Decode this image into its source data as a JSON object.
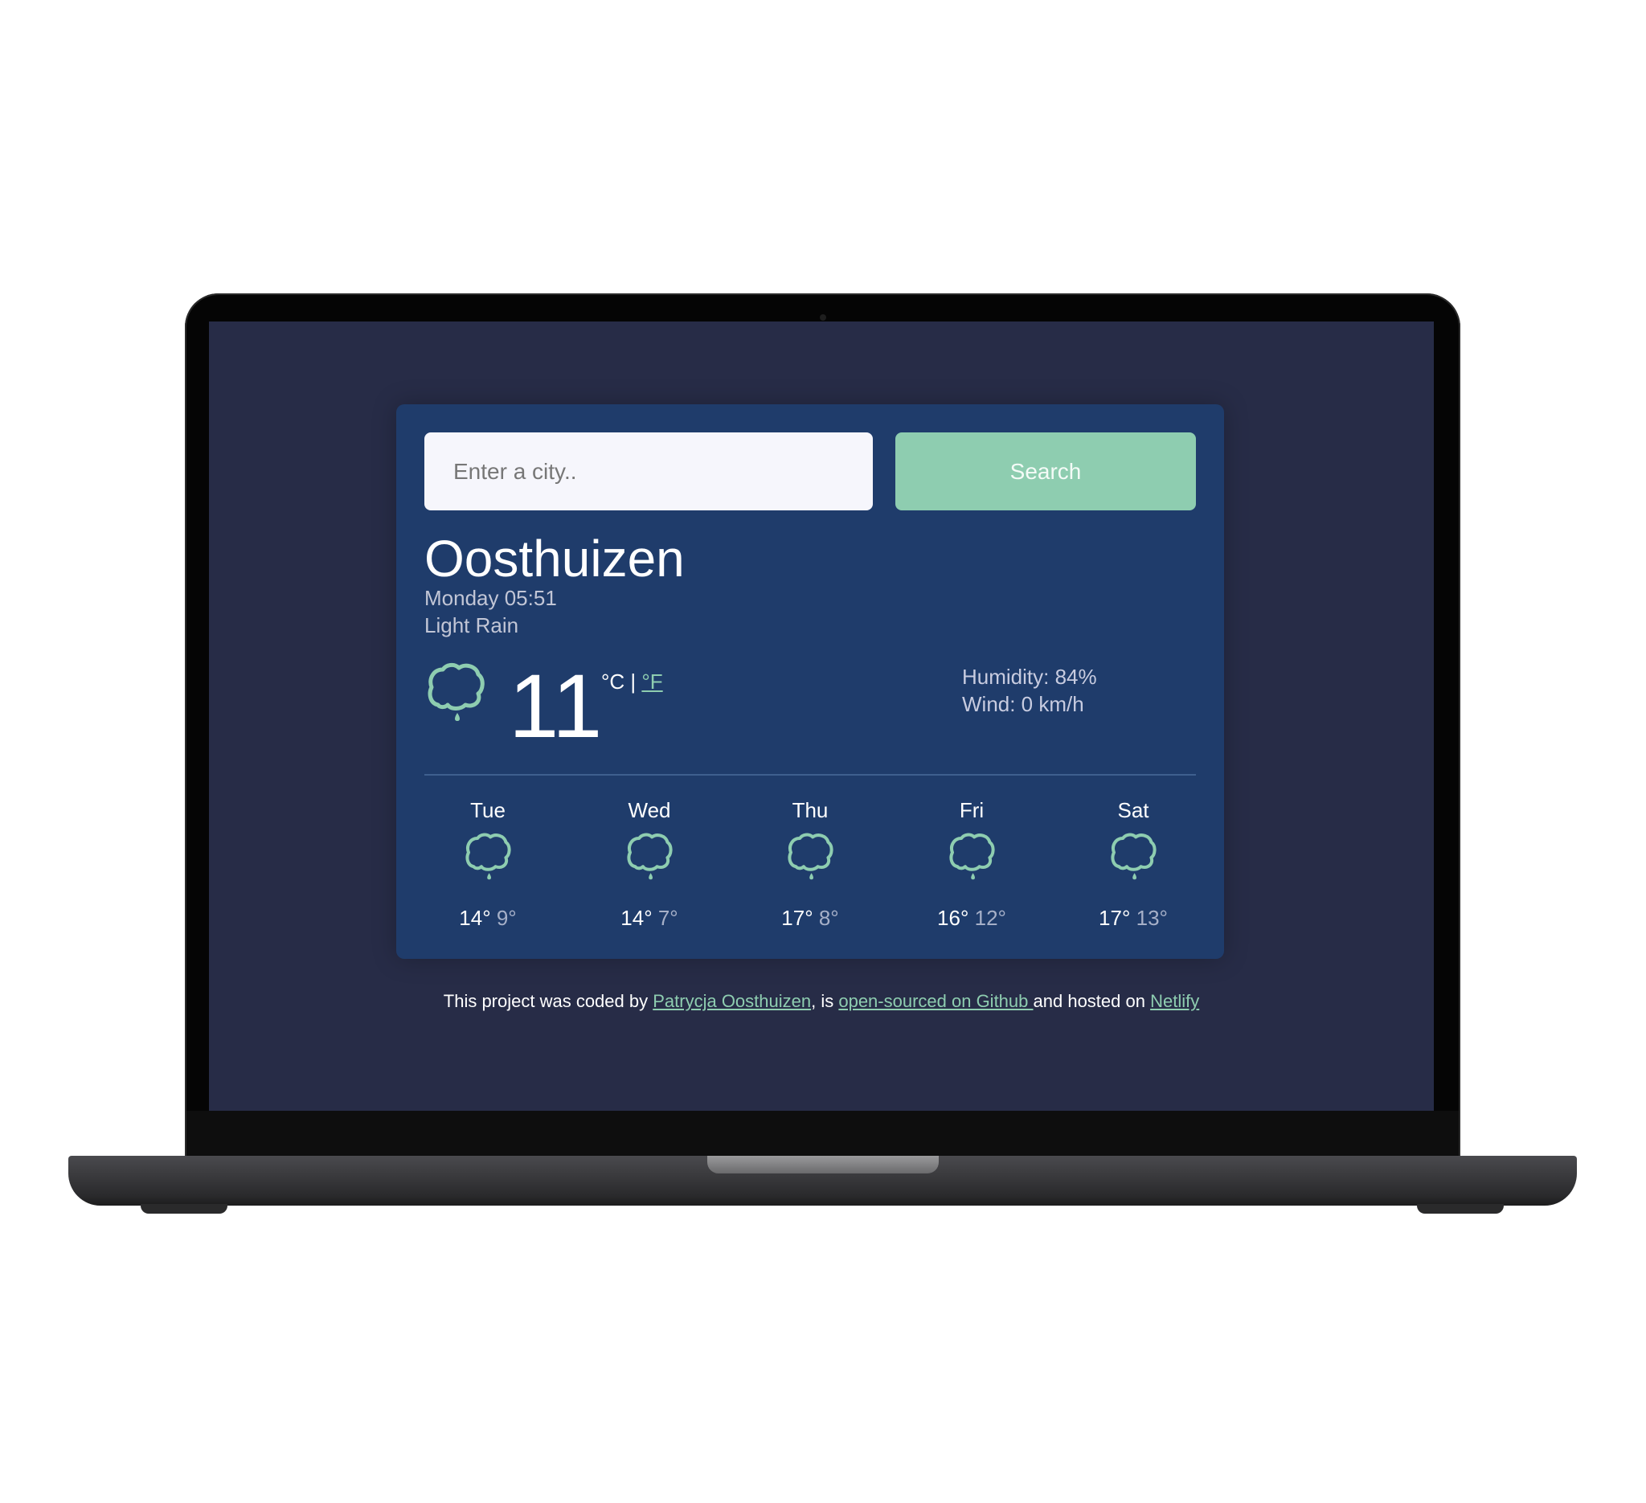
{
  "search": {
    "placeholder": "Enter a city..",
    "value": "",
    "button_label": "Search"
  },
  "current": {
    "city": "Oosthuizen",
    "date_time": "Monday 05:51",
    "description": "Light Rain",
    "icon": "light-rain-cloud-icon",
    "temperature": "11",
    "unit_celsius": "°C",
    "unit_separator": " | ",
    "unit_fahrenheit": "°F",
    "humidity": "Humidity: 84%",
    "wind": "Wind: 0 km/h"
  },
  "forecast": [
    {
      "day": "Tue",
      "icon": "light-rain-cloud-icon",
      "max": "14°",
      "min": "9°"
    },
    {
      "day": "Wed",
      "icon": "light-rain-cloud-icon",
      "max": "14°",
      "min": "7°"
    },
    {
      "day": "Thu",
      "icon": "light-rain-cloud-icon",
      "max": "17°",
      "min": "8°"
    },
    {
      "day": "Fri",
      "icon": "light-rain-cloud-icon",
      "max": "16°",
      "min": "12°"
    },
    {
      "day": "Sat",
      "icon": "light-rain-cloud-icon",
      "max": "17°",
      "min": "13°"
    }
  ],
  "footer": {
    "text_1": "This project was coded by ",
    "author_link": "Patrycja Oosthuizen",
    "text_2": ", is ",
    "github_link": "open-sourced on Github ",
    "text_3": "and hosted on ",
    "netlify_link": "Netlify"
  },
  "colors": {
    "accent": "#8ecdb0",
    "card": "#1f3c6b",
    "page_background": "#272c47"
  }
}
